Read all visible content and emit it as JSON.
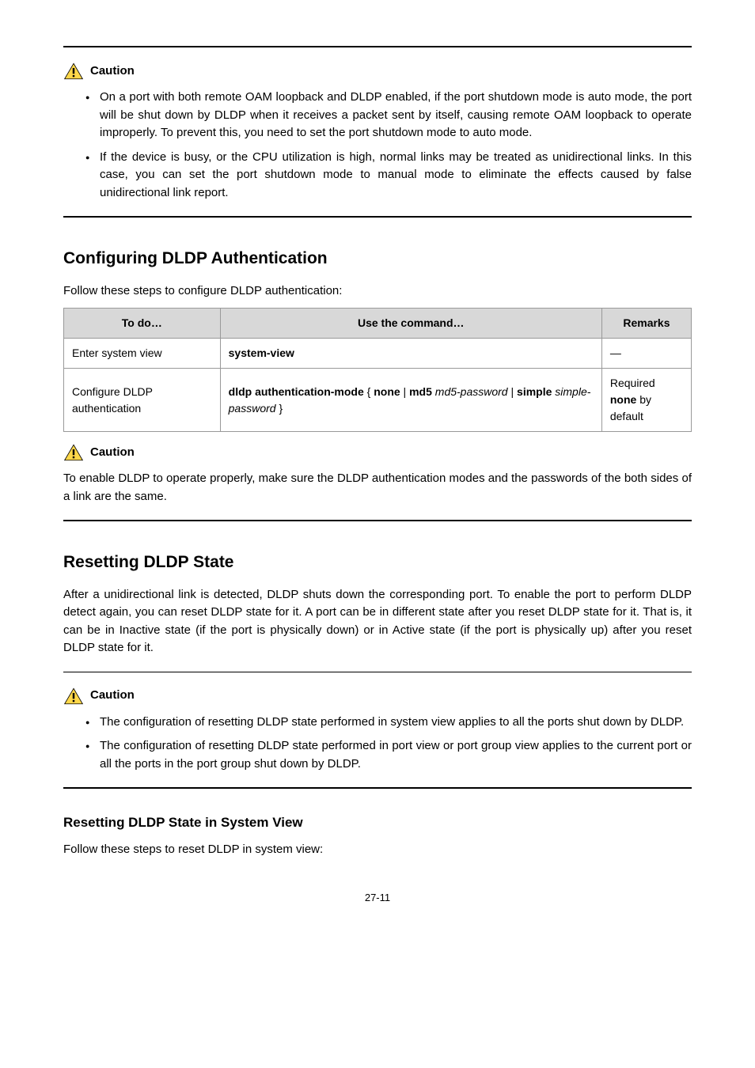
{
  "caution1": {
    "label": "Caution",
    "bullets": [
      "On a port with both remote OAM loopback and DLDP enabled, if the port shutdown mode is auto mode, the port will be shut down by DLDP when it receives a packet sent by itself, causing remote OAM loopback to operate improperly. To prevent this, you need to set the port shutdown mode to auto mode.",
      "If the device is busy, or the CPU utilization is high, normal links may be treated as unidirectional links. In this case, you can set the port shutdown mode to manual mode to eliminate the effects caused by false unidirectional link report."
    ]
  },
  "auth": {
    "heading": "Configuring DLDP Authentication",
    "intro": "Follow these steps to configure DLDP authentication:",
    "headers": {
      "todo": "To do…",
      "cmd": "Use the command…",
      "remarks": "Remarks"
    },
    "rows": [
      {
        "todo": "Enter system view",
        "cmd_bold": "system-view",
        "cmd_rest": "",
        "remarks": "—"
      },
      {
        "todo": "Configure DLDP authentication",
        "cmd_bold": "dldp authentication-mode",
        "cmd_rest": " { none | md5 md5-password | simple simple-password }",
        "remarks_line1": "Required",
        "remarks_line2": "none by default"
      }
    ]
  },
  "caution2": {
    "label": "Caution",
    "text": "To enable DLDP to operate properly, make sure the DLDP authentication modes and the passwords of the both sides of a link are the same."
  },
  "reset": {
    "heading": "Resetting DLDP State",
    "text": "After a unidirectional link is detected, DLDP shuts down the corresponding port. To enable the port to perform DLDP detect again, you can reset DLDP state for it. A port can be in different state after you reset DLDP state for it. That is, it can be in Inactive state (if the port is physically down) or in Active state (if the port is physically up) after you reset DLDP state for it."
  },
  "caution3": {
    "label": "Caution",
    "bullets": [
      "The configuration of resetting DLDP state performed in system view applies to all the ports shut down by DLDP.",
      "The configuration of resetting DLDP state performed in port view or port group view applies to the current port or all the ports in the port group shut down by DLDP."
    ]
  },
  "reset_sys": {
    "heading": "Resetting DLDP State in System View",
    "intro": "Follow these steps to reset DLDP in system view:"
  },
  "page_number": "27-11"
}
